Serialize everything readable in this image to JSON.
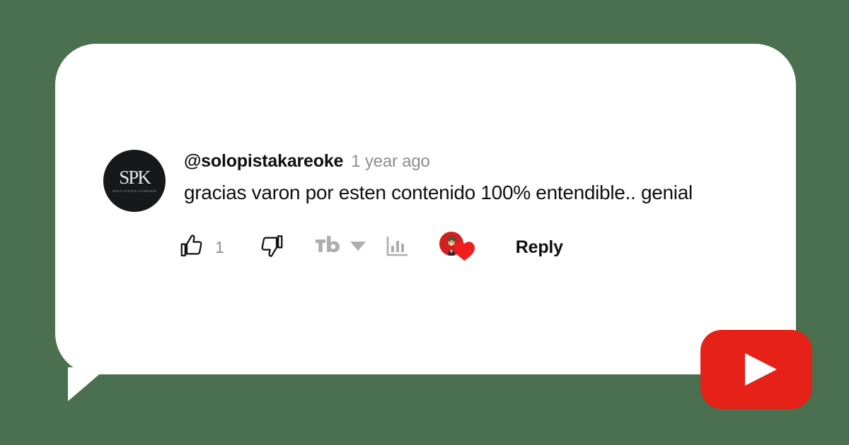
{
  "theme": {
    "background_color": "#4a7050",
    "bubble_color": "#ffffff",
    "text_color": "#0f0f0f",
    "muted_text_color": "#8e8e8e",
    "youtube_red": "#e62117",
    "heart_red": "#ef1f1f",
    "tubebuddy_gray": "#aeaeae"
  },
  "comment": {
    "avatar": {
      "monogram": "SPK",
      "subtitle": "SOLO PISTAS\nKAREOKE"
    },
    "author": "@solopistakareoke",
    "timestamp": "1 year ago",
    "text": "gracias varon por esten contenido 100% entendible.. genial",
    "actions": {
      "like_count": "1",
      "like_icon": "thumbs-up-icon",
      "dislike_icon": "thumbs-down-icon",
      "tubebuddy_icon": "tubebuddy-logo-icon",
      "tubebuddy_dropdown_icon": "chevron-down-icon",
      "analytics_icon": "bar-chart-icon",
      "reaction_icon": "creator-heart-icon",
      "reply_label": "Reply"
    }
  },
  "branding": {
    "logo": "youtube-play-logo"
  }
}
